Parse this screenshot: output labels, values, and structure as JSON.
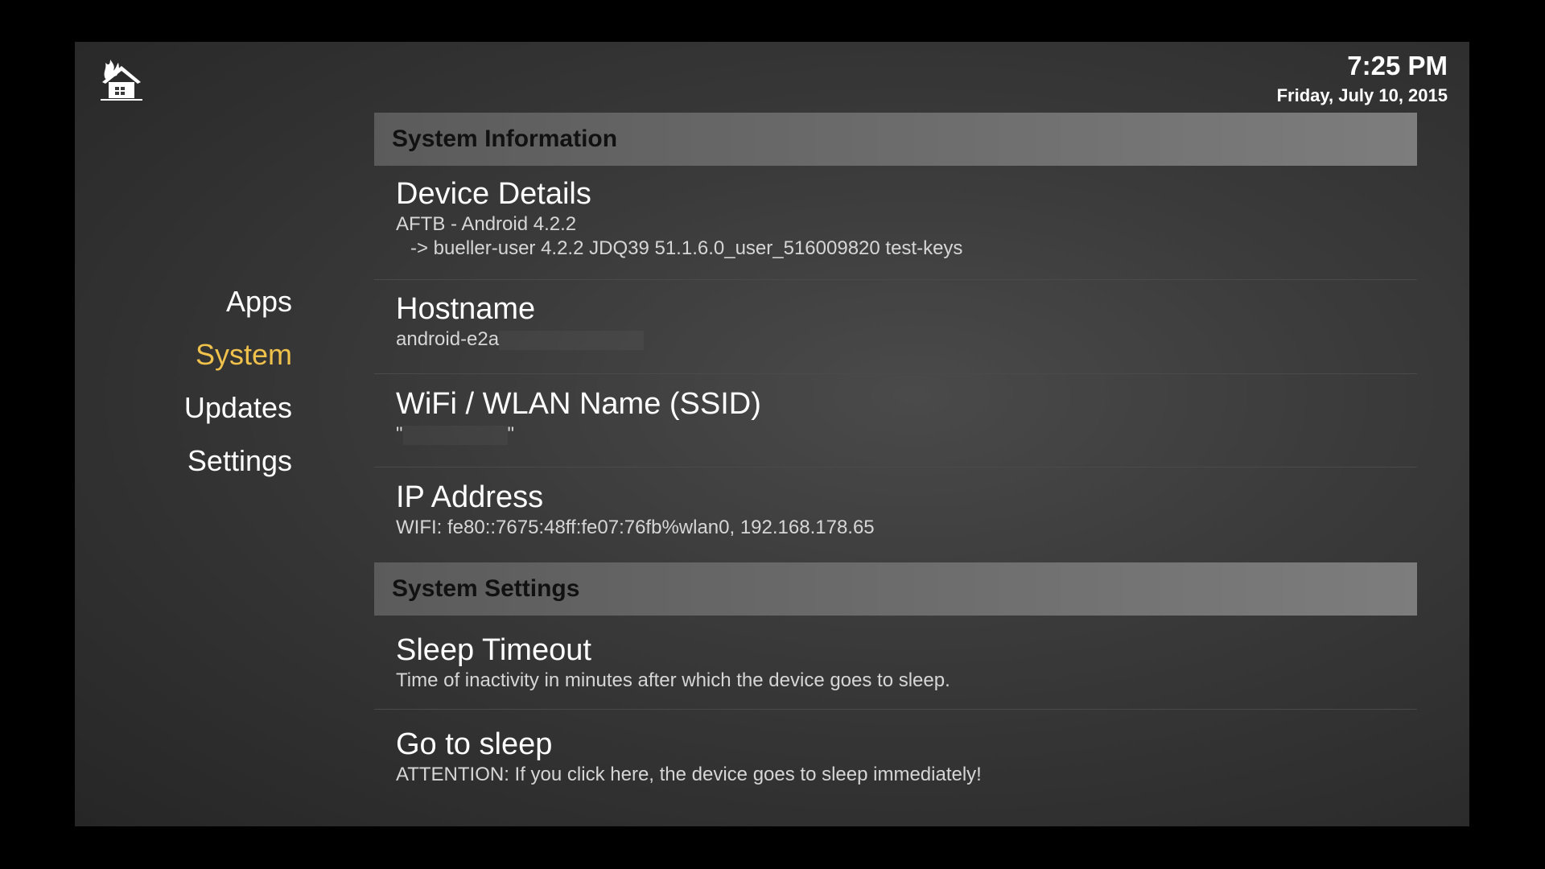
{
  "header": {
    "time": "7:25 PM",
    "date": "Friday, July 10, 2015"
  },
  "nav": {
    "items": [
      {
        "label": "Apps"
      },
      {
        "label": "System"
      },
      {
        "label": "Updates"
      },
      {
        "label": "Settings"
      }
    ],
    "active": "System"
  },
  "sections": {
    "info": {
      "header": "System Information",
      "device": {
        "title": "Device Details",
        "line1": "AFTB - Android 4.2.2",
        "line2": "-> bueller-user 4.2.2 JDQ39 51.1.6.0_user_516009820 test-keys"
      },
      "hostname": {
        "title": "Hostname",
        "value": "android-e2a"
      },
      "wifi": {
        "title": "WiFi / WLAN Name (SSID)",
        "open_quote": "\"",
        "close_quote": "\""
      },
      "ip": {
        "title": "IP Address",
        "value": "WIFI: fe80::7675:48ff:fe07:76fb%wlan0, 192.168.178.65"
      }
    },
    "settings": {
      "header": "System Settings",
      "sleep_timeout": {
        "title": "Sleep Timeout",
        "description": "Time of inactivity in minutes after which the device goes to sleep."
      },
      "go_to_sleep": {
        "title": "Go to sleep",
        "description": "ATTENTION: If you click here, the device goes to sleep immediately!"
      }
    }
  },
  "colors": {
    "accent": "#f0c24b",
    "background": "#3a3a3a",
    "section_header": "#6b6b6b"
  }
}
